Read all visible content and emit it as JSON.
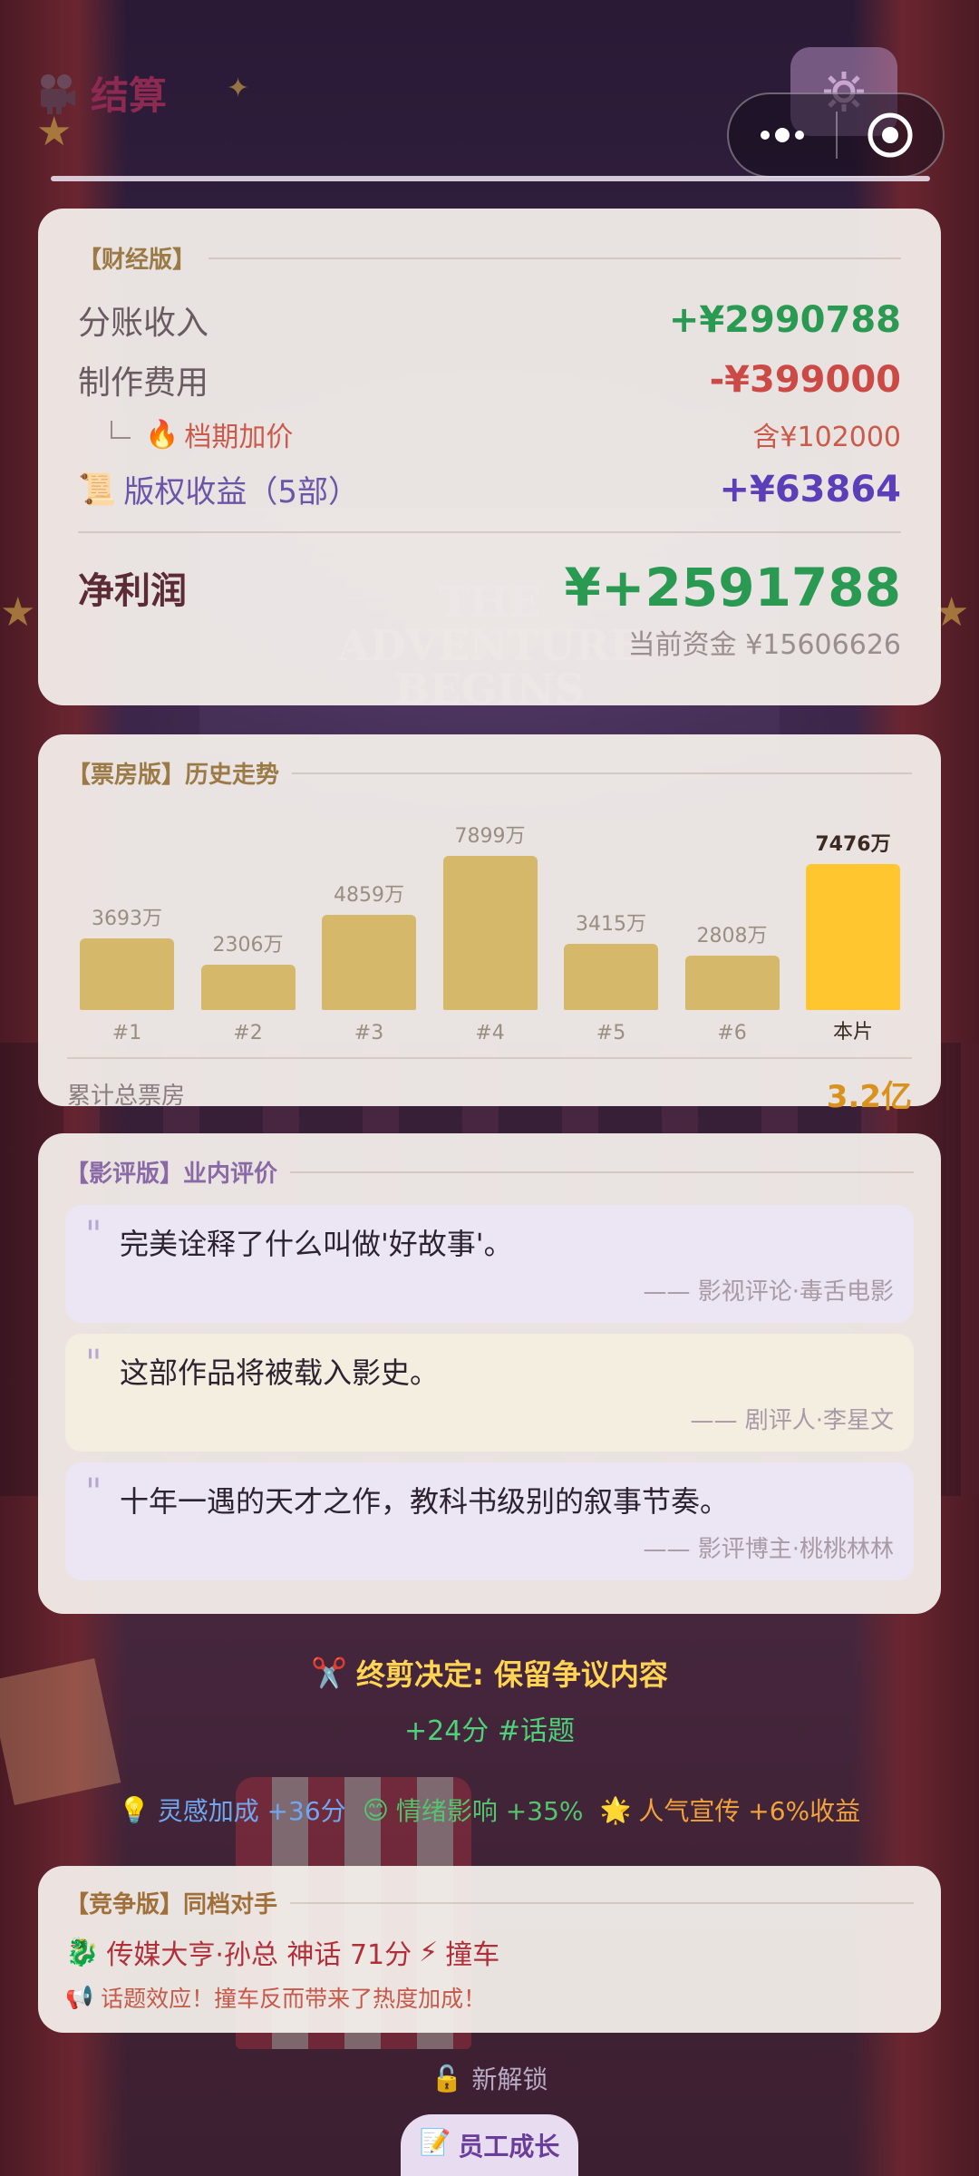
{
  "header": {
    "title": "结算"
  },
  "finance": {
    "section_label": "【财经版】",
    "revenue_label": "分账收入",
    "revenue_value": "+¥2990788",
    "cost_label": "制作费用",
    "cost_value": "-¥399000",
    "premium_label": "档期加价",
    "premium_value": "含¥102000",
    "royalty_label": "版权收益（5部）",
    "royalty_value": "+¥63864",
    "net_label": "净利润",
    "net_value": "¥+2591788",
    "funds_text": "当前资金 ¥15606626"
  },
  "boxoffice": {
    "section_label": "【票房版】历史走势",
    "total_label": "累计总票房",
    "total_value": "3.2亿"
  },
  "chart_data": {
    "type": "bar",
    "categories": [
      "#1",
      "#2",
      "#3",
      "#4",
      "#5",
      "#6",
      "本片"
    ],
    "values": [
      3693,
      2306,
      4859,
      7899,
      3415,
      2808,
      7476
    ],
    "value_labels": [
      "3693万",
      "2306万",
      "4859万",
      "7899万",
      "3415万",
      "2808万",
      "7476万"
    ],
    "highlight_index": 6,
    "colors": {
      "bar": "#d6b86a",
      "highlight": "#ffc630"
    },
    "title": "",
    "xlabel": "",
    "ylabel": ""
  },
  "reviews": {
    "section_label": "【影评版】业内评价",
    "items": [
      {
        "text": "完美诠释了什么叫做'好故事'。",
        "by": "—— 影视评论·毒舌电影"
      },
      {
        "text": "这部作品将被载入影史。",
        "by": "—— 剧评人·李星文"
      },
      {
        "text": "十年一遇的天才之作，教科书级别的叙事节奏。",
        "by": "—— 影评博主·桃桃林林"
      }
    ]
  },
  "finalcut": {
    "title": "终剪决定: 保留争议内容",
    "sub": "+24分 #话题"
  },
  "effects": {
    "inspiration": "灵感加成 +36分",
    "emotion": "情绪影响 +35%",
    "promo": "人气宣传 +6%收益"
  },
  "competition": {
    "section_label": "【竞争版】同档对手",
    "rival": "传媒大亨·孙总 神话 71分",
    "clash": "撞车",
    "note": "话题效应！撞车反而带来了热度加成！"
  },
  "footer": {
    "unlock": "新解锁",
    "growth_button": "员工成长"
  }
}
